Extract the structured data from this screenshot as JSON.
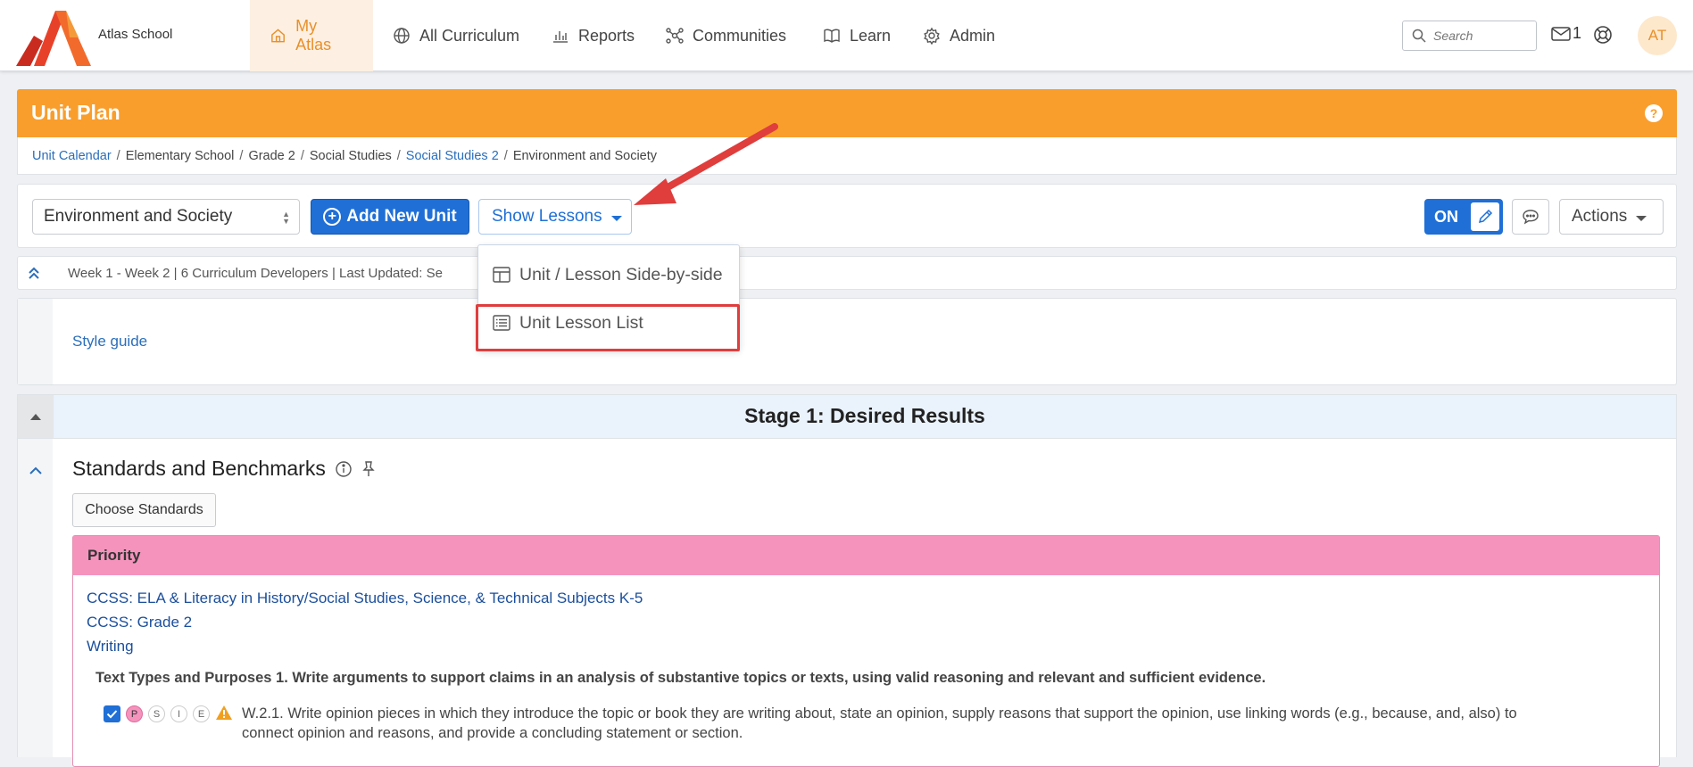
{
  "app": {
    "school_name": "Atlas School",
    "user_initials": "AT",
    "mail_count": "1",
    "search_placeholder": "Search"
  },
  "nav": {
    "items": [
      {
        "label": "My Atlas",
        "icon": "home-icon",
        "active": true
      },
      {
        "label": "All Curriculum",
        "icon": "globe-icon"
      },
      {
        "label": "Reports",
        "icon": "bar-chart-icon"
      },
      {
        "label": "Communities",
        "icon": "network-icon"
      },
      {
        "label": "Learn",
        "icon": "book-icon"
      },
      {
        "label": "Admin",
        "icon": "gear-icon"
      }
    ]
  },
  "header": {
    "title": "Unit Plan",
    "help": "?"
  },
  "breadcrumb": {
    "items": [
      {
        "label": "Unit Calendar",
        "link": true
      },
      {
        "label": "Elementary School",
        "link": false
      },
      {
        "label": "Grade 2",
        "link": false
      },
      {
        "label": "Social Studies",
        "link": false
      },
      {
        "label": "Social Studies 2",
        "link": true
      },
      {
        "label": "Environment and Society",
        "link": false
      }
    ],
    "separator": "/"
  },
  "toolbar": {
    "unit_select_value": "Environment and Society",
    "add_unit_label": "Add New Unit",
    "show_lessons_label": "Show Lessons",
    "toggle_label": "ON",
    "actions_label": "Actions"
  },
  "dropdown": {
    "items": [
      {
        "label": "Unit / Lesson Side-by-side",
        "icon": "columns-icon"
      },
      {
        "label": "Unit Lesson List",
        "icon": "list-icon"
      }
    ]
  },
  "meta": {
    "text": "Week 1 - Week 2 |  6 Curriculum Developers |  Last Updated: Se"
  },
  "style_guide": {
    "link_label": "Style guide"
  },
  "stage": {
    "title": "Stage 1: Desired Results"
  },
  "standards": {
    "section_title": "Standards and Benchmarks",
    "choose_label": "Choose Standards",
    "priority_label": "Priority",
    "links": [
      "CCSS: ELA & Literacy in History/Social Studies, Science, & Technical Subjects K-5",
      "CCSS: Grade 2",
      "Writing"
    ],
    "heading_text": "Text Types and Purposes 1. Write arguments to support claims in an analysis of substantive topics or texts, using valid reasoning and relevant and sufficient evidence.",
    "pills": [
      "P",
      "S",
      "I",
      "E"
    ],
    "standard_line1": "W.2.1. Write opinion pieces in which they introduce the topic or book they are writing about, state an opinion, supply reasons that support the opinion, use linking words (e.g., because, and, also) to",
    "standard_line2": "connect opinion and reasons, and provide a concluding statement or section."
  },
  "colors": {
    "brand_orange": "#f99e2c",
    "primary_blue": "#1f6fd6",
    "priority_pink": "#f593bd",
    "annotation_red": "#e03d3d"
  }
}
